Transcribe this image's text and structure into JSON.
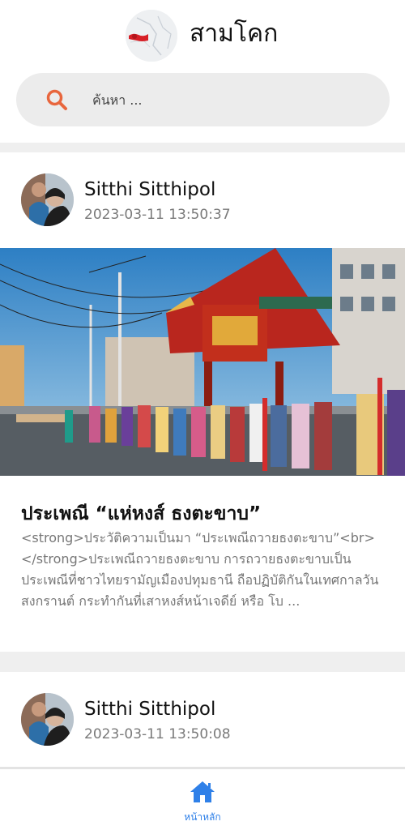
{
  "header": {
    "title": "สามโคก",
    "logo_icon": "map-pin-logo-icon"
  },
  "search": {
    "placeholder": "ค้นหา ...",
    "icon": "search-icon",
    "icon_color": "#e8663d"
  },
  "posts": [
    {
      "author": "Sitthi Sitthipol",
      "timestamp": "2023-03-11 13:50:37",
      "title": "ประเพณี “แห่หงส์ ธงตะขาบ”",
      "excerpt": "<strong>ประวัติความเป็นมา “ประเพณีถวายธงตะขาบ”<br></strong>ประเพณีถวายธงตะขาบ การถวายธงตะขาบเป็นประเพณีที่ชาวไทยรามัญเมืองปทุมธานี ถือปฏิบัติกันในเทศกาลวันสงกรานต์ กระทำกันที่เสาหงส์หน้าเจดีย์ หรือ โบ ..."
    },
    {
      "author": "Sitthi Sitthipol",
      "timestamp": "2023-03-11 13:50:08"
    }
  ],
  "bottom_nav": {
    "home_label": "หน้าหลัก",
    "home_icon": "home-icon",
    "accent": "#2f80e8"
  }
}
